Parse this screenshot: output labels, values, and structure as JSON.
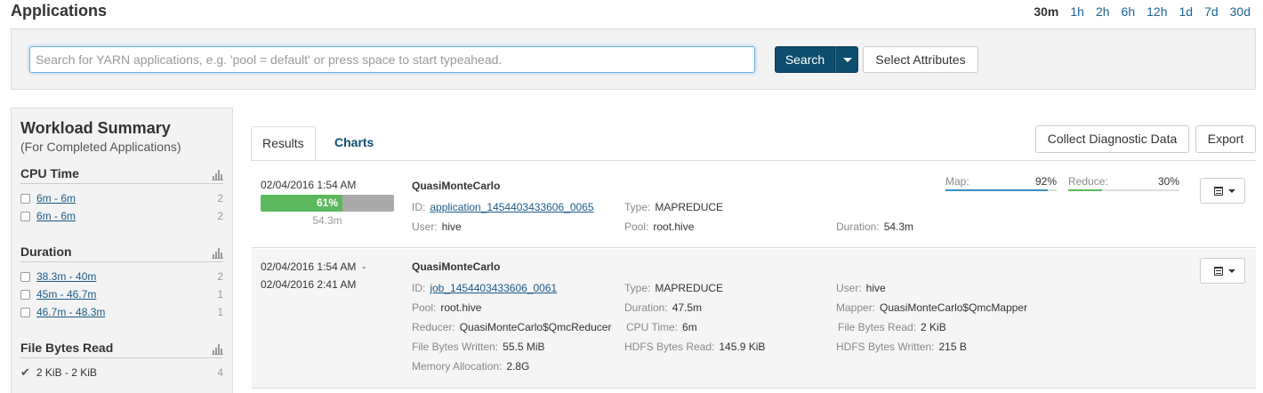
{
  "header": {
    "title": "Applications"
  },
  "timerange": [
    "30m",
    "1h",
    "2h",
    "6h",
    "12h",
    "1d",
    "7d",
    "30d"
  ],
  "search": {
    "placeholder": "Search for YARN applications, e.g. 'pool = default' or press space to start typeahead.",
    "button_label": "Search",
    "select_attributes_label": "Select Attributes"
  },
  "sidebar": {
    "title": "Workload Summary",
    "subtitle": "(For Completed Applications)",
    "facets": {
      "cpu": {
        "title": "CPU Time",
        "items": [
          {
            "label": "6m - 6m",
            "count": "2"
          },
          {
            "label": "6m - 6m",
            "count": "2"
          }
        ]
      },
      "duration": {
        "title": "Duration",
        "items": [
          {
            "label": "38.3m - 40m",
            "count": "2"
          },
          {
            "label": "45m - 46.7m",
            "count": "1"
          },
          {
            "label": "46.7m - 48.3m",
            "count": "1"
          }
        ]
      },
      "fbr": {
        "title": "File Bytes Read",
        "items": [
          {
            "label": "2 KiB - 2 KiB",
            "count": "4"
          }
        ]
      }
    }
  },
  "tabs": {
    "results": "Results",
    "charts": "Charts"
  },
  "actions": {
    "collect": "Collect Diagnostic Data",
    "export": "Export"
  },
  "rows": [
    {
      "timestamp": "02/04/2016 1:54 AM",
      "progress_label": "61%",
      "progress": 0.61,
      "duration_under": "54.3m",
      "name": "QuasiMonteCarlo",
      "id_key": "ID:",
      "id": "application_1454403433606_0065",
      "type_key": "Type:",
      "type": "MAPREDUCE",
      "user_key": "User:",
      "user": "hive",
      "pool_key": "Pool:",
      "pool": "root.hive",
      "duration_key": "Duration:",
      "duration": "54.3m",
      "map_key": "Map:",
      "map": "92%",
      "map_fraction": 0.92,
      "reduce_key": "Reduce:",
      "reduce": "30%",
      "reduce_fraction": 0.3
    },
    {
      "timestamp_start": "02/04/2016 1:54 AM",
      "dash": "-",
      "timestamp_end": "02/04/2016 2:41 AM",
      "name": "QuasiMonteCarlo",
      "id_key": "ID:",
      "id": "job_1454403433606_0061",
      "type_key": "Type:",
      "type": "MAPREDUCE",
      "user_key": "User:",
      "user": "hive",
      "pool_key": "Pool:",
      "pool": "root.hive",
      "duration_key": "Duration:",
      "duration": "47.5m",
      "mapper_key": "Mapper:",
      "mapper": "QuasiMonteCarlo$QmcMapper",
      "reducer_key": "Reducer:",
      "reducer": "QuasiMonteCarlo$QmcReducer",
      "cpu_key": "CPU Time:",
      "cpu": "6m",
      "fbr_key": "File Bytes Read:",
      "fbr": "2 KiB",
      "fbw_key": "File Bytes Written:",
      "fbw": "55.5 MiB",
      "hbr_key": "HDFS Bytes Read:",
      "hbr": "145.9 KiB",
      "hbw_key": "HDFS Bytes Written:",
      "hbw": "215 B",
      "mem_key": "Memory Allocation:",
      "mem": "2.8G"
    }
  ],
  "colors": {
    "accent": "#0d4d6e",
    "progress": "#5cb85c",
    "map_bar": "#3a8fbf",
    "reduce_bar": "#5cb85c"
  }
}
